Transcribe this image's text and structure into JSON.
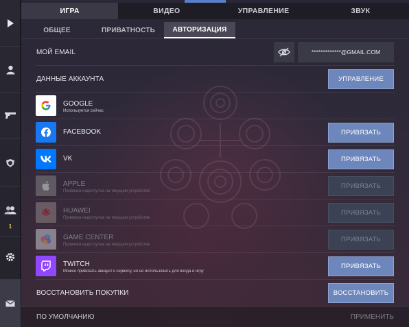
{
  "top_tabs": [
    "ИГРА",
    "ВИДЕО",
    "УПРАВЛЕНИЕ",
    "ЗВУК"
  ],
  "sub_tabs": [
    "ОБЩЕЕ",
    "ПРИВАТНОСТЬ",
    "АВТОРИЗАЦИЯ"
  ],
  "sidebar": {
    "friends_count": "1",
    "icons": [
      "play-icon",
      "profile-icon",
      "weapon-icon",
      "clan-icon",
      "friends-icon",
      "gear-icon",
      "mail-icon"
    ]
  },
  "email": {
    "label": "МОЙ EMAIL",
    "value": "*************@GMAIL.COM"
  },
  "account": {
    "label": "ДАННЫЕ АККАУНТА",
    "button": "УПРАВЛЕНИЕ"
  },
  "providers": [
    {
      "name": "GOOGLE",
      "sub": "Используется сейчас",
      "button": ""
    },
    {
      "name": "FACEBOOK",
      "sub": "",
      "button": "ПРИВЯЗАТЬ"
    },
    {
      "name": "VK",
      "sub": "",
      "button": "ПРИВЯЗАТЬ"
    },
    {
      "name": "APPLE",
      "sub": "Привязка недоступна на текущем устройстве",
      "button": "ПРИВЯЗАТЬ"
    },
    {
      "name": "HUAWEI",
      "sub": "Привязка недоступна на текущем устройстве",
      "button": "ПРИВЯЗАТЬ"
    },
    {
      "name": "GAME CENTER",
      "sub": "Привязка недоступна на текущем устройстве",
      "button": "ПРИВЯЗАТЬ"
    },
    {
      "name": "TWITCH",
      "sub": "Можно привязать аккаунт к сервису, но не использовать для входа в игру",
      "button": "ПРИВЯЗАТЬ"
    }
  ],
  "restore": {
    "label": "ВОССТАНОВИТЬ ПОКУПКИ",
    "button": "ВОССТАНОВИТЬ"
  },
  "footer": {
    "default_label": "ПО УМОЛЧАНИЮ",
    "apply_label": "ПРИМЕНИТЬ"
  },
  "colors": {
    "accent_button": "#6d86bb",
    "facebook": "#1877f2",
    "vk": "#0077ff",
    "twitch": "#9146ff",
    "apple": "#8a8a8a",
    "huawei": "#c7162b"
  }
}
